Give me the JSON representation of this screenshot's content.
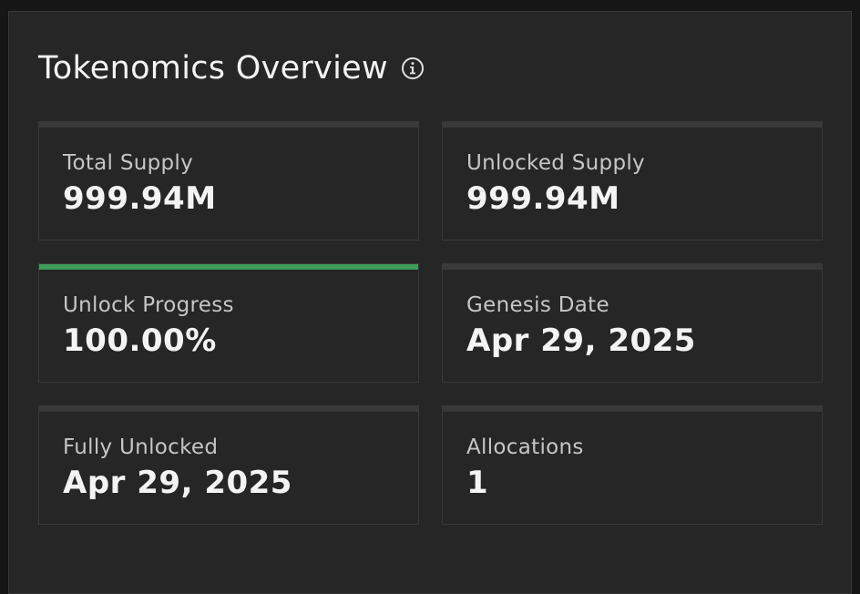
{
  "header": {
    "title": "Tokenomics Overview",
    "info_icon": "info-circle-icon"
  },
  "colors": {
    "progress_fill": "#42be65",
    "background": "#262626",
    "border": "#393939"
  },
  "cards": [
    {
      "label": "Total Supply",
      "value": "999.94M"
    },
    {
      "label": "Unlocked Supply",
      "value": "999.94M"
    },
    {
      "label": "Unlock Progress",
      "value": "100.00%",
      "progress_fraction": 1.0
    },
    {
      "label": "Genesis Date",
      "value": "Apr 29, 2025"
    },
    {
      "label": "Fully Unlocked",
      "value": "Apr 29, 2025"
    },
    {
      "label": "Allocations",
      "value": "1"
    }
  ]
}
